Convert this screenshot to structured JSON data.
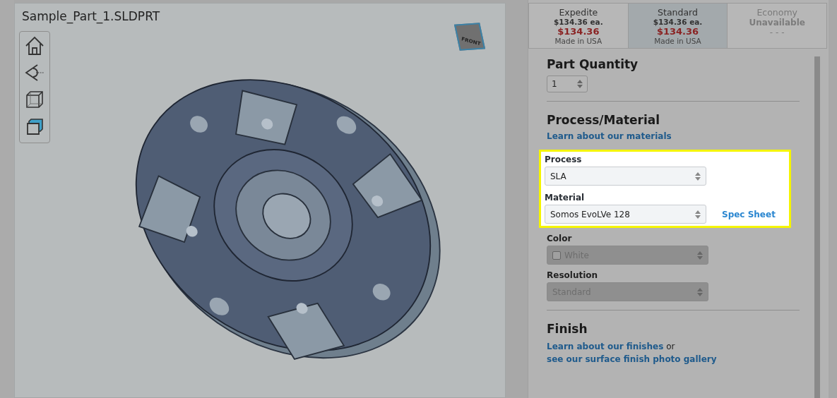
{
  "viewer": {
    "title": "Sample_Part_1.SLDPRT",
    "view_cube_label": "FRONT"
  },
  "shipping_options": [
    {
      "name": "Expedite",
      "available": true,
      "selected": false,
      "unit_price": "$134.36 ea.",
      "total": "$134.36",
      "origin": "Made in USA"
    },
    {
      "name": "Standard",
      "available": true,
      "selected": true,
      "unit_price": "$134.36 ea.",
      "total": "$134.36",
      "origin": "Made in USA"
    },
    {
      "name": "Economy",
      "available": false,
      "selected": false,
      "status": "Unavailable",
      "total": "- - -"
    }
  ],
  "quantity": {
    "heading": "Part Quantity",
    "value": "1"
  },
  "process_material": {
    "heading": "Process/Material",
    "link": "Learn about our materials",
    "spotlight": [
      {
        "label": "Process",
        "value": "SLA"
      },
      {
        "label": "Material",
        "value": "Somos EvoLVe 128",
        "link": "Spec Sheet"
      }
    ],
    "fields": [
      {
        "label": "Color",
        "value": "White",
        "swatch": true,
        "disabled": true
      },
      {
        "label": "Resolution",
        "value": "Standard",
        "swatch": false,
        "disabled": true
      }
    ]
  },
  "finish": {
    "heading": "Finish",
    "link": "Learn about our finishes",
    "joiner": "or",
    "link_2": "see our surface finish photo gallery"
  }
}
